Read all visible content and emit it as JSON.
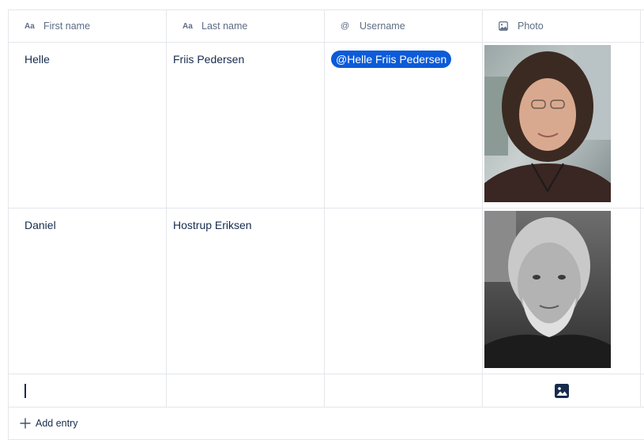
{
  "columns": [
    {
      "label": "First name",
      "icon": "text-type-icon",
      "glyph": "Aa"
    },
    {
      "label": "Last name",
      "icon": "text-type-icon",
      "glyph": "Aa"
    },
    {
      "label": "Username",
      "icon": "at-icon",
      "glyph": "@"
    },
    {
      "label": "Photo",
      "icon": "image-icon"
    }
  ],
  "rows": [
    {
      "first_name": "Helle",
      "last_name": "Friis Pedersen",
      "username": "@Helle Friis Pedersen",
      "photo": "portrait-woman-curly-hair-glasses"
    },
    {
      "first_name": "Daniel",
      "last_name": "Hostrup Eriksen",
      "username": "",
      "photo": "portrait-man-beard-monochrome"
    }
  ],
  "footer": {
    "add_entry_label": "Add entry",
    "add_icon": "plus-icon"
  },
  "colors": {
    "mention_bg": "#0c5bd8",
    "text": "#172b4d",
    "header_text": "#5e6c84",
    "border": "#e4e6ea"
  }
}
